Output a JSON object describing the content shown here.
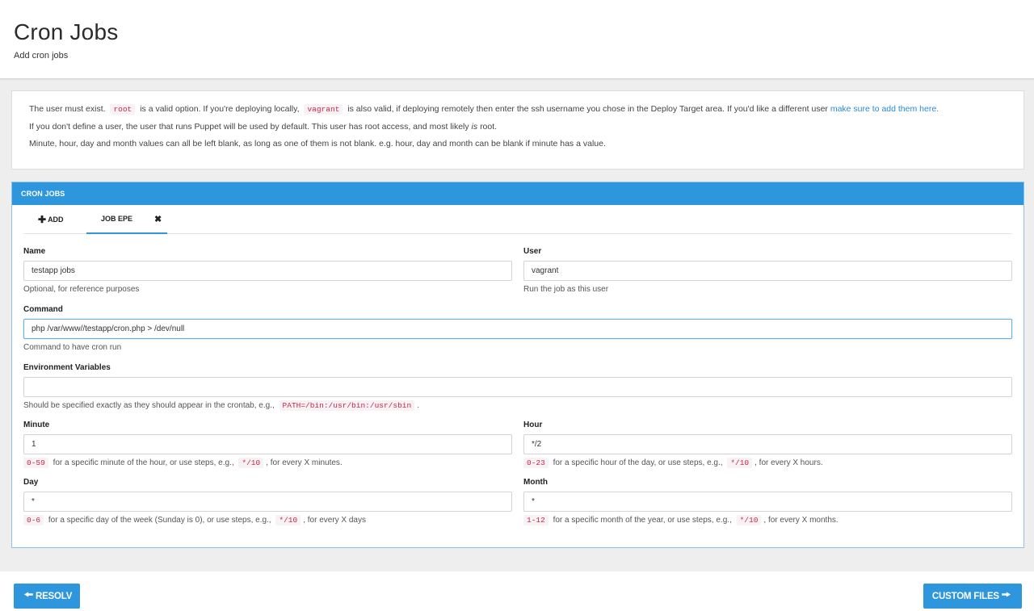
{
  "header": {
    "title": "Cron Jobs",
    "subtitle": "Add cron jobs"
  },
  "info": {
    "line1_a": "The user must exist.",
    "line1_code1": "root",
    "line1_b": "is a valid option. If you're deploying locally,",
    "line1_code2": "vagrant",
    "line1_c": "is also valid, if deploying remotely then enter the ssh username you chose in the Deploy Target area. If you'd like a different user",
    "line1_link": "make sure to add them here.",
    "line2_a": "If you don't define a user, the user that runs Puppet will be used by default. This user has root access, and most likely",
    "line2_em": "is",
    "line2_b": "root.",
    "line3": "Minute, hour, day and month values can all be left blank, as long as one of them is not blank. e.g. hour, day and month can be blank if minute has a value."
  },
  "panel": {
    "title": "CRON JOBS",
    "tabs": {
      "add_label": "ADD",
      "add_icon": "plus-icon",
      "job_label": "JOB EPE",
      "close_icon": "close-icon"
    }
  },
  "form": {
    "name": {
      "label": "Name",
      "value": "testapp jobs",
      "help": "Optional, for reference purposes"
    },
    "user": {
      "label": "User",
      "value": "vagrant",
      "help": "Run the job as this user"
    },
    "command": {
      "label": "Command",
      "value": "php /var/www//testapp/cron.php > /dev/null",
      "help": "Command to have cron run"
    },
    "env": {
      "label": "Environment Variables",
      "value": "",
      "help_a": "Should be specified exactly as they should appear in the crontab, e.g.,",
      "help_code": "PATH=/bin:/usr/bin:/usr/sbin",
      "help_b": "."
    },
    "minute": {
      "label": "Minute",
      "value": "1",
      "help_code1": "0-59",
      "help_a": "for a specific minute of the hour, or use steps, e.g.,",
      "help_code2": "*/10",
      "help_b": ", for every X minutes."
    },
    "hour": {
      "label": "Hour",
      "value": "*/2",
      "help_code1": "0-23",
      "help_a": "for a specific hour of the day, or use steps, e.g.,",
      "help_code2": "*/10",
      "help_b": ", for every X hours."
    },
    "day": {
      "label": "Day",
      "value": "*",
      "help_code1": "0-6",
      "help_a": "for a specific day of the week (Sunday is 0), or use steps, e.g.,",
      "help_code2": "*/10",
      "help_b": ", for every X days"
    },
    "month": {
      "label": "Month",
      "value": "*",
      "help_code1": "1-12",
      "help_a": "for a specific month of the year, or use steps, e.g.,",
      "help_code2": "*/10",
      "help_b": ", for every X months."
    }
  },
  "footer": {
    "back_label": "RESOLV",
    "back_icon": "arrow-left-icon",
    "next_label": "CUSTOM FILES",
    "next_icon": "arrow-right-icon"
  },
  "colors": {
    "accent": "#2d96dc",
    "link": "#2a8ad4",
    "code_text": "#c7254e",
    "code_bg": "#f9f2f4",
    "background": "#eeeeee"
  }
}
